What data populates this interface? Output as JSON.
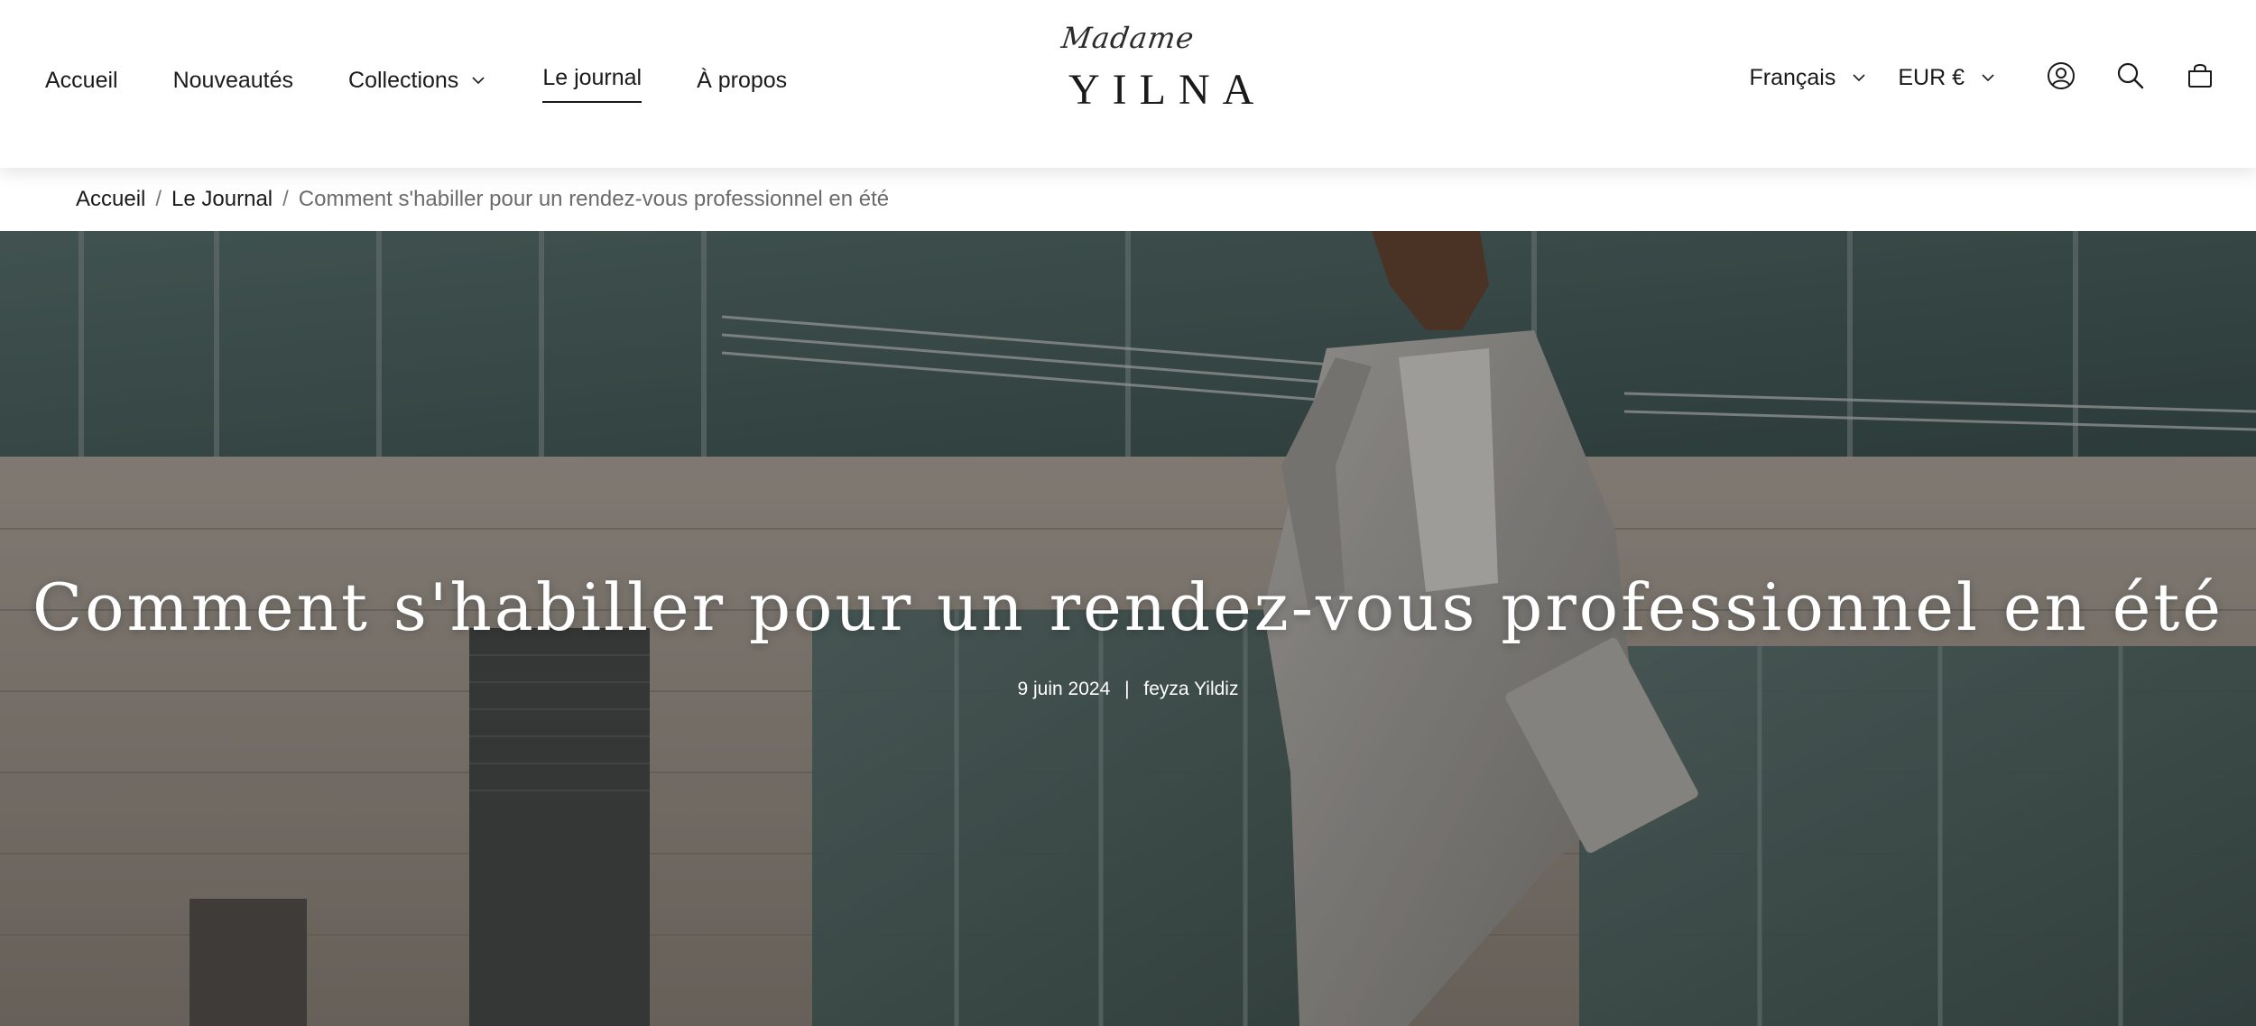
{
  "nav": {
    "items": [
      {
        "label": "Accueil",
        "dropdown": false,
        "active": false
      },
      {
        "label": "Nouveautés",
        "dropdown": false,
        "active": false
      },
      {
        "label": "Collections",
        "dropdown": true,
        "active": false
      },
      {
        "label": "Le journal",
        "dropdown": false,
        "active": true
      },
      {
        "label": "À propos",
        "dropdown": false,
        "active": false
      }
    ]
  },
  "logo": {
    "script": "Madame",
    "main": "YILNA"
  },
  "header_right": {
    "language": "Français",
    "currency": "EUR €",
    "icons": [
      "account-icon",
      "search-icon",
      "cart-icon"
    ]
  },
  "breadcrumb": {
    "items": [
      "Accueil",
      "Le Journal"
    ],
    "separator": "/",
    "current": "Comment s'habiller pour un rendez-vous professionnel en été"
  },
  "article": {
    "title": "Comment s'habiller pour un rendez-vous professionnel en été",
    "date": "9 juin 2024",
    "meta_separator": "|",
    "author": "feyza Yildiz"
  },
  "colors": {
    "text": "#1a1a1a",
    "muted": "#6b6b6b",
    "hero_text": "#ffffff"
  }
}
